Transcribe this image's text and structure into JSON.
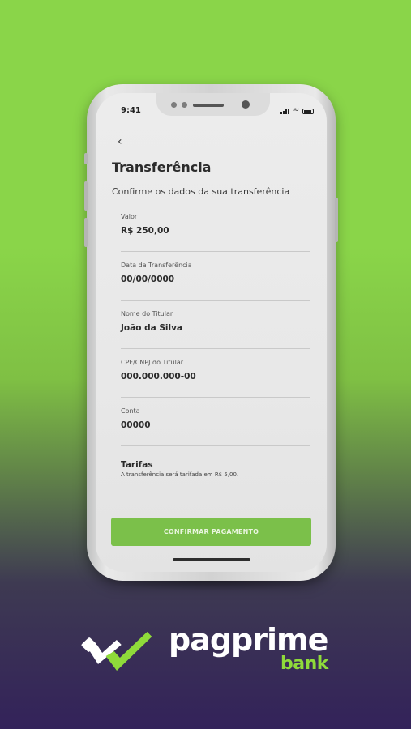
{
  "status_bar": {
    "time": "9:41"
  },
  "header": {
    "title": "Transferência",
    "subtitle": "Confirme os dados da sua transferência"
  },
  "fields": [
    {
      "label": "Valor",
      "value": "R$ 250,00"
    },
    {
      "label": "Data da Transferência",
      "value": "00/00/0000"
    },
    {
      "label": "Nome do Titular",
      "value": "João da Silva"
    },
    {
      "label": "CPF/CNPJ do Titular",
      "value": "000.000.000-00"
    },
    {
      "label": "Conta",
      "value": "00000"
    }
  ],
  "tarifas": {
    "title": "Tarifas",
    "text": "A transferência será tarifada em R$ 5,00."
  },
  "confirm_button": {
    "label": "CONFIRMAR PAGAMENTO"
  },
  "brand": {
    "name": "pagprime",
    "sub": "bank",
    "accent_color": "#8fdb3a"
  },
  "icons": {
    "back": "back-arrow-icon",
    "wifi": "wifi-icon",
    "battery": "battery-icon",
    "signal": "signal-icon"
  }
}
